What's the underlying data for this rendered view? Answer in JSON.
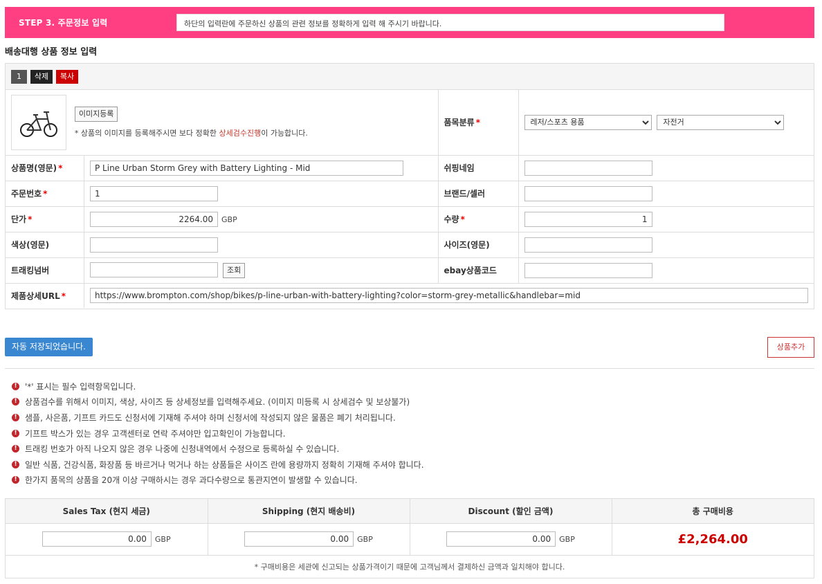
{
  "step": {
    "title": "STEP 3. 주문정보 입력",
    "message": "하단의 입력란에 주문하신 상품의 관련 정보를 정확하게 입력 해 주시기 바랍니다."
  },
  "section_title": "배송대행 상품 정보 입력",
  "item": {
    "number": "1",
    "delete_label": "삭제",
    "copy_label": "복사",
    "image_register_label": "이미지등록",
    "image_note_before": "* 상품의 이미지를 등록해주시면 보다 정확한 ",
    "image_note_highlight": "상세검수진행",
    "image_note_after": "이 가능합니다.",
    "category_label": "품목분류",
    "category_main": "레저/스포츠 용품",
    "category_sub": "자전거",
    "name_label": "상품명(영문)",
    "name_value": "P Line Urban Storm Grey with Battery Lighting - Mid",
    "shopping_name_label": "쉬핑네임",
    "shopping_name_value": "",
    "order_no_label": "주문번호",
    "order_no_value": "1",
    "brand_label": "브랜드/셀러",
    "brand_value": "",
    "price_label": "단가",
    "price_value": "2264.00",
    "price_unit": "GBP",
    "qty_label": "수량",
    "qty_value": "1",
    "color_label": "색상(영문)",
    "color_value": "",
    "size_label": "사이즈(영문)",
    "size_value": "",
    "tracking_label": "트래킹넘버",
    "tracking_value": "",
    "lookup_label": "조회",
    "ebay_label": "ebay상품코드",
    "ebay_value": "",
    "url_label": "제품상세URL",
    "url_value": "https://www.brompton.com/shop/bikes/p-line-urban-with-battery-lighting?color=storm-grey-metallic&handlebar=mid",
    "required_mark": "*"
  },
  "saved_label": "자동 저장되었습니다.",
  "add_item_label": "상품추가",
  "notices": [
    "'*' 표시는 필수 입력항목입니다.",
    "상품검수를 위해서 이미지, 색상, 사이즈 등 상세정보를 입력해주세요. (이미지 미등록 시 상세검수 및 보상불가)",
    "샘플, 사은품, 기프트 카드도 신청서에 기재해 주셔야 하며 신청서에 작성되지 않은 물품은 폐기 처리됩니다.",
    "기프트 박스가 있는 경우 고객센터로 연락 주셔야만 입고확인이 가능합니다.",
    "트래킹 번호가 아직 나오지 않은 경우 나중에 신청내역에서 수정으로 등록하실 수 있습니다.",
    "일반 식품, 건강식품, 화장품 등 바르거나 먹거나 하는 상품들은 사이즈 란에 용량까지 정확히 기재해 주셔야 합니다.",
    "한가지 품목의 상품을 20개 이상 구매하시는 경우 과다수량으로 통관지연이 발생할 수 있습니다."
  ],
  "costs": {
    "sales_tax_label": "Sales Tax (현지 세금)",
    "sales_tax_value": "0.00",
    "shipping_label": "Shipping (현지 배송비)",
    "shipping_value": "0.00",
    "discount_label": "Discount (할인 금액)",
    "discount_value": "0.00",
    "unit": "GBP",
    "total_label": "총 구매비용",
    "total_value": "£2,264.00",
    "note": "* 구매비용은 세관에 신고되는 상품가격이기 때문에 고객님께서 결제하신 금액과 일치해야 합니다."
  },
  "colors": {
    "step_bar": "#ff3f82",
    "saved_button": "#3a87d1",
    "accent_red": "#cc0000"
  }
}
